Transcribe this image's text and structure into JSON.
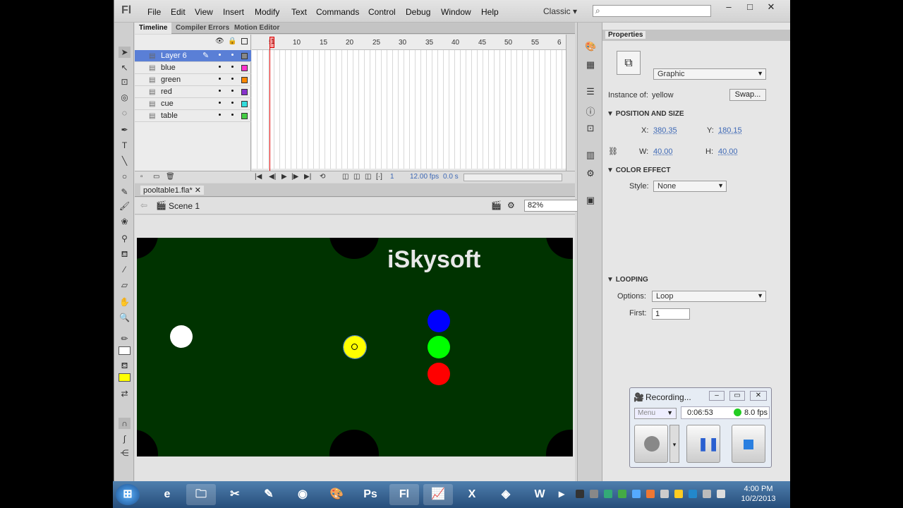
{
  "app": {
    "logo": "Fl",
    "menu": [
      "File",
      "Edit",
      "View",
      "Insert",
      "Modify",
      "Text",
      "Commands",
      "Control",
      "Debug",
      "Window",
      "Help"
    ],
    "workspace": "Classic",
    "search_icon": "search-icon"
  },
  "timeline": {
    "tabs": [
      "Timeline",
      "Compiler Errors",
      "Motion Editor"
    ],
    "frame_numbers": [
      "1",
      "5",
      "10",
      "15",
      "20",
      "25",
      "30",
      "35",
      "40",
      "45",
      "50",
      "55",
      "6"
    ],
    "layers": [
      {
        "name": "Layer 6",
        "color": "#888888",
        "selected": true
      },
      {
        "name": "blue",
        "color": "#ff33cc"
      },
      {
        "name": "green",
        "color": "#ff8800"
      },
      {
        "name": "red",
        "color": "#8833cc"
      },
      {
        "name": "cue",
        "color": "#33dddd"
      },
      {
        "name": "table",
        "color": "#44cc44"
      }
    ],
    "current_frame": "1",
    "fps": "12.00 fps",
    "elapsed": "0.0 s"
  },
  "document": {
    "file_name": "pooltable1.fla*",
    "scene": "Scene 1",
    "zoom": "82%",
    "watermark": "iSkysoft",
    "stage_color": "#003300"
  },
  "properties": {
    "tab": "Properties",
    "symbol_type": "Graphic",
    "instance_of_label": "Instance of:",
    "instance_of_value": "yellow",
    "swap_label": "Swap...",
    "position_section": "POSITION AND SIZE",
    "x_label": "X:",
    "x_value": "380.35",
    "y_label": "Y:",
    "y_value": "180.15",
    "w_label": "W:",
    "w_value": "40.00",
    "h_label": "H:",
    "h_value": "40.00",
    "color_section": "COLOR EFFECT",
    "style_label": "Style:",
    "style_value": "None",
    "looping_section": "LOOPING",
    "options_label": "Options:",
    "options_value": "Loop",
    "first_label": "First:",
    "first_value": "1"
  },
  "recorder": {
    "title": "Recording...",
    "menu": "Menu",
    "time": "0:06:53",
    "fps": "8.0 fps"
  },
  "taskbar": {
    "time": "4:00 PM",
    "date": "10/2/2013"
  }
}
